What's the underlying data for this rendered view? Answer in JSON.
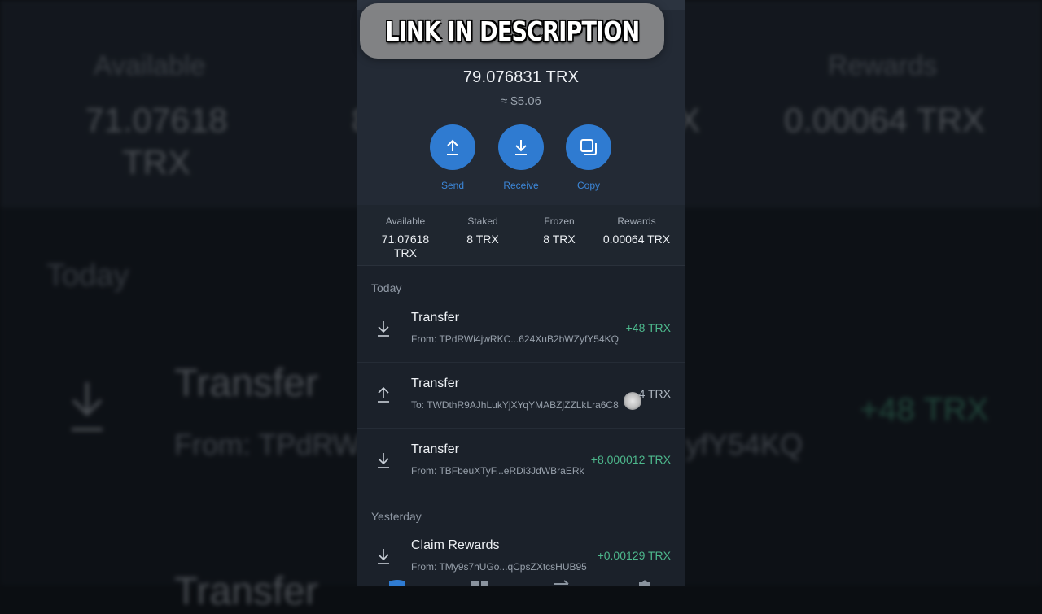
{
  "banner": {
    "text": "LINK IN DESCRIPTION",
    "icon": "link-icon"
  },
  "wallet": {
    "balance": "79.076831 TRX",
    "fiat": "≈ $5.06",
    "actions": [
      {
        "label": "Send",
        "icon": "upload-icon"
      },
      {
        "label": "Receive",
        "icon": "download-icon"
      },
      {
        "label": "Copy",
        "icon": "copy-icon"
      }
    ],
    "stats": [
      {
        "label": "Available",
        "value": "71.07618\nTRX"
      },
      {
        "label": "Staked",
        "value": "8 TRX"
      },
      {
        "label": "Frozen",
        "value": "8 TRX"
      },
      {
        "label": "Rewards",
        "value": "0.00064 TRX"
      }
    ]
  },
  "history": {
    "today_label": "Today",
    "yesterday_label": "Yesterday",
    "today": [
      {
        "title": "Transfer",
        "sub": "From: TPdRWi4jwRKC...624XuB2bWZyfY54KQ",
        "amount": "+48 TRX",
        "direction": "in"
      },
      {
        "title": "Transfer",
        "sub": "To: TWDthR9AJhLukYjXYqYMABZjZZLkLra6C8",
        "amount": "-4 TRX",
        "direction": "out"
      },
      {
        "title": "Transfer",
        "sub": "From: TBFbeuXTyF...eRDi3JdWBraERk",
        "amount": "+8.000012 TRX",
        "direction": "in"
      }
    ],
    "yesterday": [
      {
        "title": "Claim Rewards",
        "sub": "From: TMy9s7hUGo...qCpsZXtcsHUB95",
        "amount": "+0.00129 TRX",
        "direction": "in"
      }
    ]
  },
  "background_zoom": {
    "stats": [
      {
        "label": "Available",
        "value": "71.07618\nTRX"
      },
      {
        "label": "Rewards",
        "value": "0.00064 TRX"
      }
    ],
    "stat_partial_left": "8",
    "stat_partial_right": "X",
    "section": "Today",
    "tx_title": "Transfer",
    "tx_sub_left": "From: TPdRW",
    "tx_sub_right": "yfY54KQ",
    "tx_amount": "+48 TRX",
    "tx_title_cut": "Transfer"
  },
  "colors": {
    "accent": "#2f7bd1",
    "positive": "#4db88c"
  }
}
